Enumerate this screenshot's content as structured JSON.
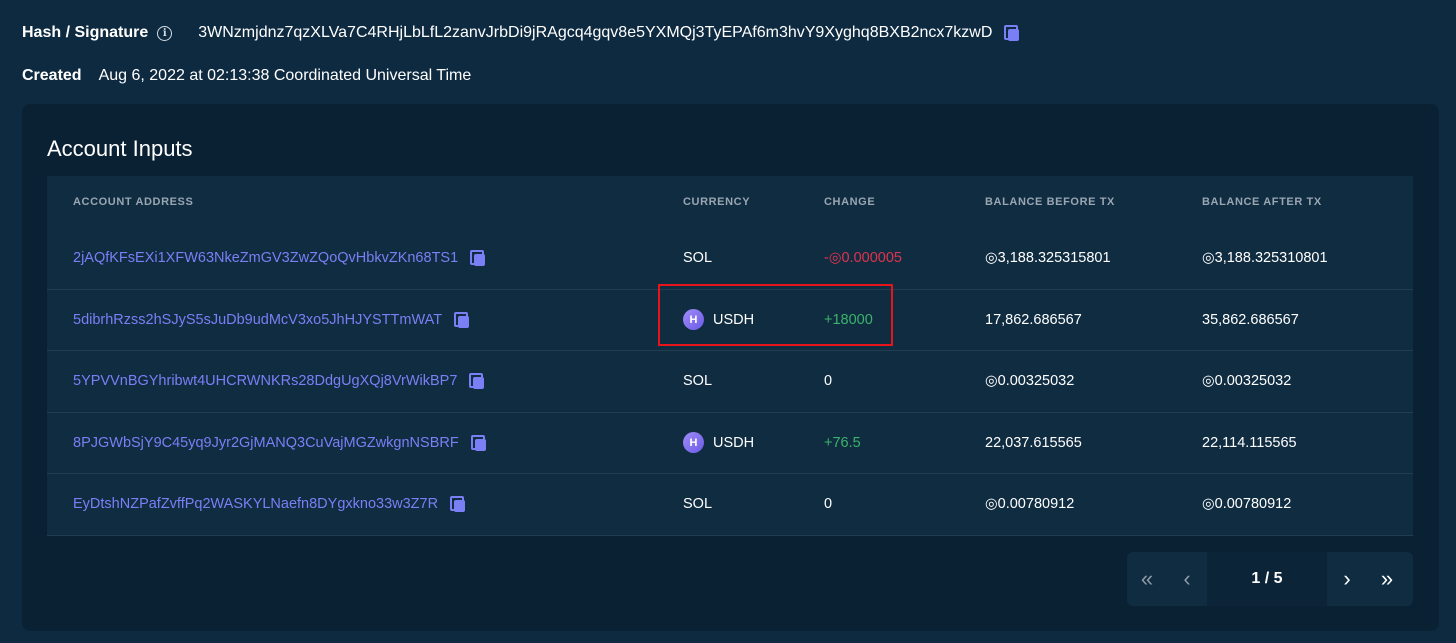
{
  "hash": {
    "label": "Hash / Signature",
    "value": "3WNzmjdnz7qzXLVa7C4RHjLbLfL2zanvJrbDi9jRAgcq4gqv8e5YXMQj3TyEPAf6m3hvY9Xyghq8BXB2ncx7kzwD"
  },
  "created": {
    "label": "Created",
    "value": "Aug 6, 2022 at 02:13:38 Coordinated Universal Time"
  },
  "card": {
    "title": "Account Inputs",
    "columns": {
      "address": "ACCOUNT ADDRESS",
      "currency": "CURRENCY",
      "change": "CHANGE",
      "balance_before": "BALANCE BEFORE TX",
      "balance_after": "BALANCE AFTER TX"
    },
    "rows": [
      {
        "address": "2jAQfKFsEXi1XFW63NkeZmGV3ZwZQoQvHbkvZKn68TS1",
        "currency": "SOL",
        "change": "-◎0.000005",
        "balance_before": "◎3,188.325315801",
        "balance_after": "◎3,188.325310801"
      },
      {
        "address": "5dibrhRzss2hSJyS5sJuDb9udMcV3xo5JhHJYSTTmWAT",
        "currency": "USDH",
        "token_icon": "H",
        "change": "+18000",
        "balance_before": "17,862.686567",
        "balance_after": "35,862.686567"
      },
      {
        "address": "5YPVVnBGYhribwt4UHCRWNKRs28DdgUgXQj8VrWikBP7",
        "currency": "SOL",
        "change": "0",
        "balance_before": "◎0.00325032",
        "balance_after": "◎0.00325032"
      },
      {
        "address": "8PJGWbSjY9C45yq9Jyr2GjMANQ3CuVajMGZwkgnNSBRF",
        "currency": "USDH",
        "token_icon": "H",
        "change": "+76.5",
        "balance_before": "22,037.615565",
        "balance_after": "22,114.115565"
      },
      {
        "address": "EyDtshNZPafZvffPq2WASKYLNaefn8DYgxkno33w3Z7R",
        "currency": "SOL",
        "change": "0",
        "balance_before": "◎0.00780912",
        "balance_after": "◎0.00780912"
      }
    ]
  },
  "pagination": {
    "first": "«",
    "prev": "‹",
    "page": "1 / 5",
    "next": "›",
    "last": "»"
  },
  "colors": {
    "link": "#7b7ff5",
    "negative": "#e0344e",
    "positive": "#3cb36b",
    "highlight": "#e8141c"
  },
  "icons": {
    "info": "info-icon",
    "copy": "copy-icon",
    "token": "usdh-token-icon"
  }
}
